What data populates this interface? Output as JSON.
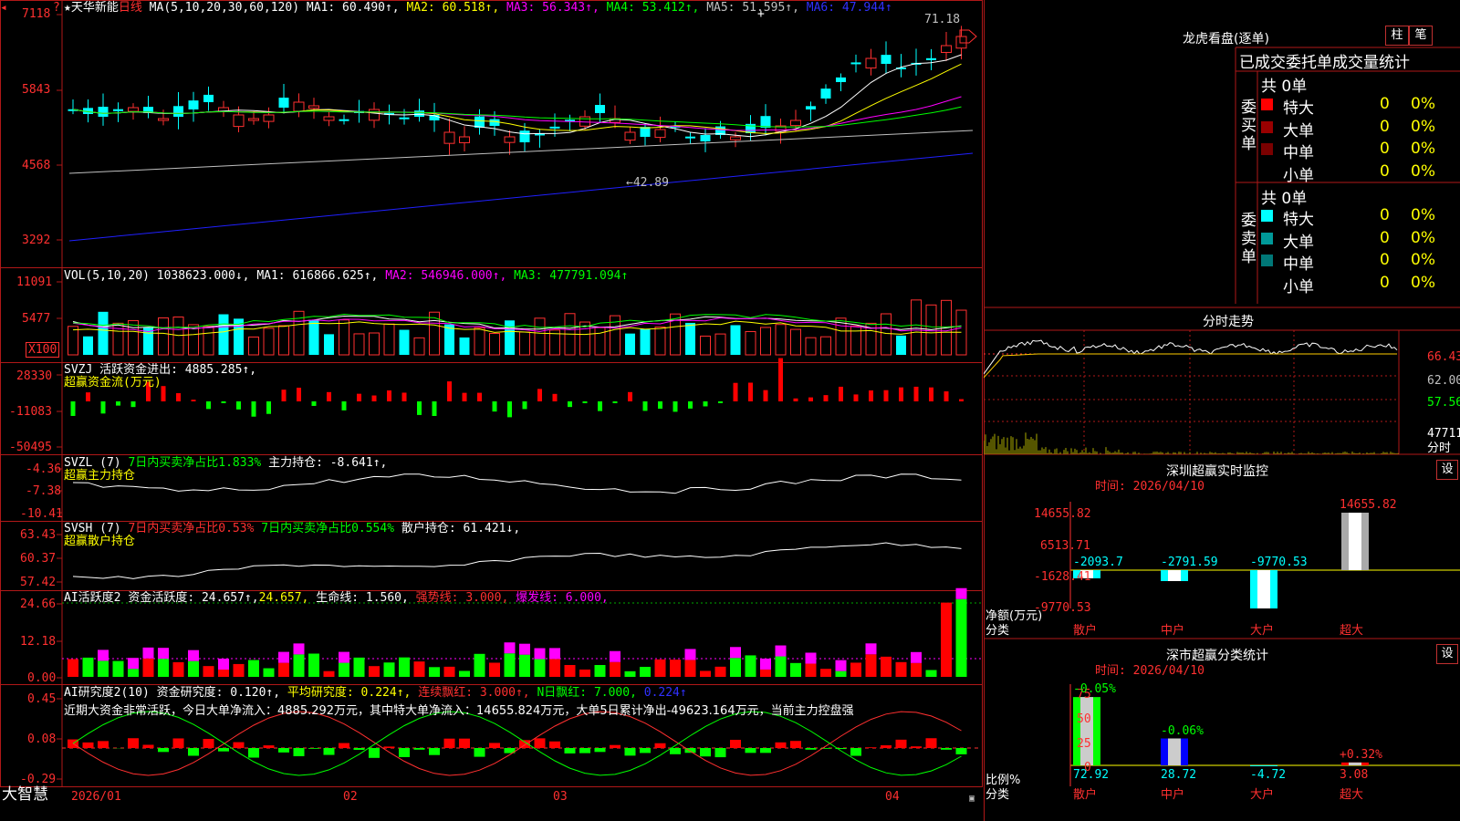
{
  "main": {
    "stock_name": "★天华新能",
    "period": "日线",
    "ma_desc": "MA(5,10,20,30,60,120)",
    "ma1": "MA1: 60.490↑,",
    "ma2": "MA2: 60.518↑,",
    "ma3": "MA3: 56.343↑,",
    "ma4": "MA4: 53.412↑,",
    "ma5": "MA5: 51.595↑,",
    "ma6": "MA6: 47.944↑",
    "high_marker": "71.18",
    "low_marker": "←42.89",
    "y_ticks": [
      "7118",
      "5843",
      "4568",
      "3292"
    ]
  },
  "vol": {
    "title": "VOL(5,10,20)",
    "value": "1038623.000↓,",
    "ma1": "MA1: 616866.625↑,",
    "ma2": "MA2: 546946.000↑,",
    "ma3": "MA3: 477791.094↑",
    "y_ticks": [
      "11091",
      "5477"
    ],
    "unit": "X100"
  },
  "svzj": {
    "title": "SVZJ  活跃资金进出: 4885.285↑,",
    "subtitle": "超赢资金流(万元)",
    "y_ticks": [
      "28330",
      "-11083",
      "-50495"
    ]
  },
  "svzl": {
    "title": "SVZL (7)",
    "ratio": "7日内买卖净占比1.833%",
    "holding": "主力持仓: -8.641↑,",
    "subtitle": "超赢主力持仓",
    "y_ticks": [
      "-4.36",
      "-7.38",
      "-10.41"
    ]
  },
  "svsh": {
    "title": "SVSH (7)",
    "ratio1": "7日内买卖净占比0.53%",
    "ratio2": "7日内买卖净占比0.554%",
    "holding": "散户持仓: 61.421↓,",
    "subtitle": "超赢散户持仓",
    "y_ticks": [
      "63.43",
      "60.37",
      "57.42"
    ]
  },
  "ai1": {
    "title": "AI活跃度2",
    "active": "资金活跃度: 24.657↑,",
    "active2": "24.657,",
    "life": "生命线: 1.560,",
    "strong": "强势线: 3.000,",
    "burst": "爆发线: 6.000,",
    "y_ticks": [
      "24.66",
      "12.18",
      "0.00"
    ]
  },
  "ai2": {
    "title": "AI研究度2(10)",
    "research": "资金研究度: 0.120↑,",
    "avg": "平均研究度: 0.224↑,",
    "cont": "连续飘红: 3.000↑,",
    "nday": "N日飘红: 7.000,",
    "val": "0.224↑",
    "comment": "近期大资金非常活跃，今日大单净流入：4885.292万元，其中特大单净流入：14655.824万元，大单5日累计净出-49623.164万元，当前主力控盘强",
    "y_ticks": [
      "0.45",
      "0.08",
      "-0.29"
    ]
  },
  "xaxis": {
    "labels": [
      "2026/01",
      "02",
      "03",
      "04"
    ],
    "brand": "大智慧"
  },
  "right": {
    "lhb_title": "龙虎看盘(逐单)",
    "btn_zhu": "柱",
    "btn_bi": "笔",
    "stats_header": "已成交委托单成交量统计",
    "buy_side": "委买单",
    "sell_side": "委卖单",
    "buy_total": "共 0单",
    "sell_total": "共 0单",
    "buy_rows": [
      {
        "label": "特大",
        "count": "0",
        "pct": "0%",
        "color": "#ff0000"
      },
      {
        "label": "大单",
        "count": "0",
        "pct": "0%",
        "color": "#990000"
      },
      {
        "label": "中单",
        "count": "0",
        "pct": "0%",
        "color": "#7a0000"
      },
      {
        "label": "小单",
        "count": "0",
        "pct": "0%",
        "color": "#000000"
      }
    ],
    "sell_rows": [
      {
        "label": "特大",
        "count": "0",
        "pct": "0%",
        "color": "#00ffff"
      },
      {
        "label": "大单",
        "count": "0",
        "pct": "0%",
        "color": "#009999"
      },
      {
        "label": "中单",
        "count": "0",
        "pct": "0%",
        "color": "#007777"
      },
      {
        "label": "小单",
        "count": "0",
        "pct": "0%",
        "color": "#000000"
      }
    ],
    "fs_title": "分时走势",
    "fs_prices": [
      "66.43",
      "62.00",
      "57.56"
    ],
    "fs_vol": "47711",
    "fs_foot": "分时",
    "sz_title": "深圳超赢实时监控",
    "sz_time": "时间: 2026/04/10",
    "sz_btn": "设",
    "sz_y": [
      "14655.82",
      "6513.71",
      "-1628.41",
      "-9770.53"
    ],
    "sz_ylabel": "净额(万元)",
    "sz_xlabel": "分类",
    "sz_bars": [
      {
        "cat": "散户",
        "value": "-2093.7"
      },
      {
        "cat": "中户",
        "value": "-2791.59"
      },
      {
        "cat": "大户",
        "value": "-9770.53"
      },
      {
        "cat": "超大",
        "value": "14655.82"
      }
    ],
    "ss_title": "深市超赢分类统计",
    "ss_time": "时间: 2026/04/10",
    "ss_btn": "设",
    "ss_y": [
      "75",
      "50",
      "25",
      "0"
    ],
    "ss_ylabel": "比例%",
    "ss_xlabel": "分类",
    "ss_bars": [
      {
        "cat": "散户",
        "value": "72.92",
        "delta": "-0.05%"
      },
      {
        "cat": "中户",
        "value": "28.72",
        "delta": "-0.06%"
      },
      {
        "cat": "大户",
        "value": "-4.72",
        "delta": ""
      },
      {
        "cat": "超大",
        "value": "3.08",
        "delta": "+0.32%"
      }
    ]
  }
}
